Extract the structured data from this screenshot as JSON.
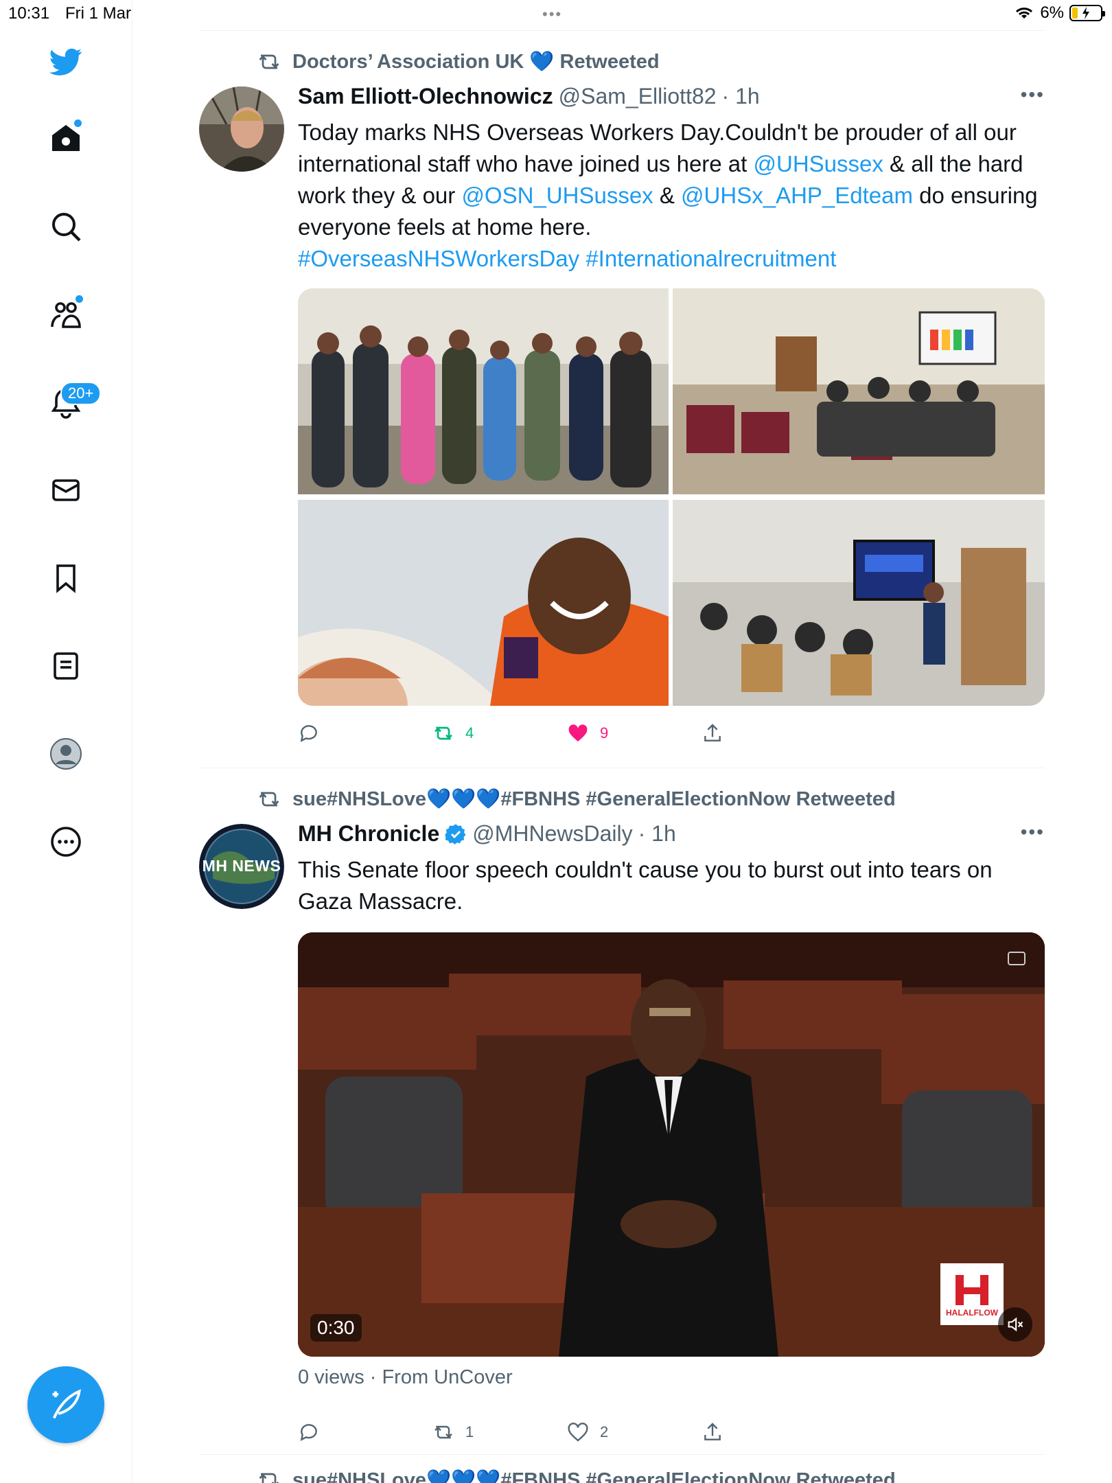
{
  "status_bar": {
    "time": "10:31",
    "date": "Fri 1 Mar",
    "battery": "6%"
  },
  "sidebar": {
    "notifications_badge": "20+"
  },
  "tweets": [
    {
      "retweeted_by": "Doctors’ Association UK 💙 Retweeted",
      "name": "Sam Elliott-Olechnowicz",
      "handle": "@Sam_Elliott82",
      "time": "· 1h",
      "text_parts": [
        "Today marks NHS Overseas Workers Day.Couldn't be prouder of all our international staff who have joined us here at ",
        "@UHSussex",
        " & all the hard work they & our ",
        "@OSN_UHSussex",
        " & ",
        "@UHSx_AHP_Edteam",
        " do ensuring everyone feels at home here.",
        "#OverseasNHSWorkersDay #Internationalrecruitment"
      ],
      "retweets": "4",
      "likes": "9"
    },
    {
      "retweeted_by": "sue#NHSLove💙💙💙#FBNHS #GeneralElectionNow Retweeted",
      "name": "MH Chronicle",
      "handle": "@MHNewsDaily",
      "time": "· 1h",
      "avatar_text": "MH NEWS",
      "text": "This Senate floor speech couldn't cause you to burst out into tears on Gaza Massacre.",
      "video_duration": "0:30",
      "video_logo": "HALALFLOW",
      "views": "0 views · From UnCover",
      "retweets": "1",
      "likes": "2"
    }
  ],
  "partial_next": "sue#NHSLove💙💙💙#FBNHS #GeneralElectionNow Retweeted",
  "colors": {
    "accent": "#1d9bf0",
    "retweet_green": "#00ba7c",
    "like_pink": "#f91880",
    "muted": "#536471"
  }
}
